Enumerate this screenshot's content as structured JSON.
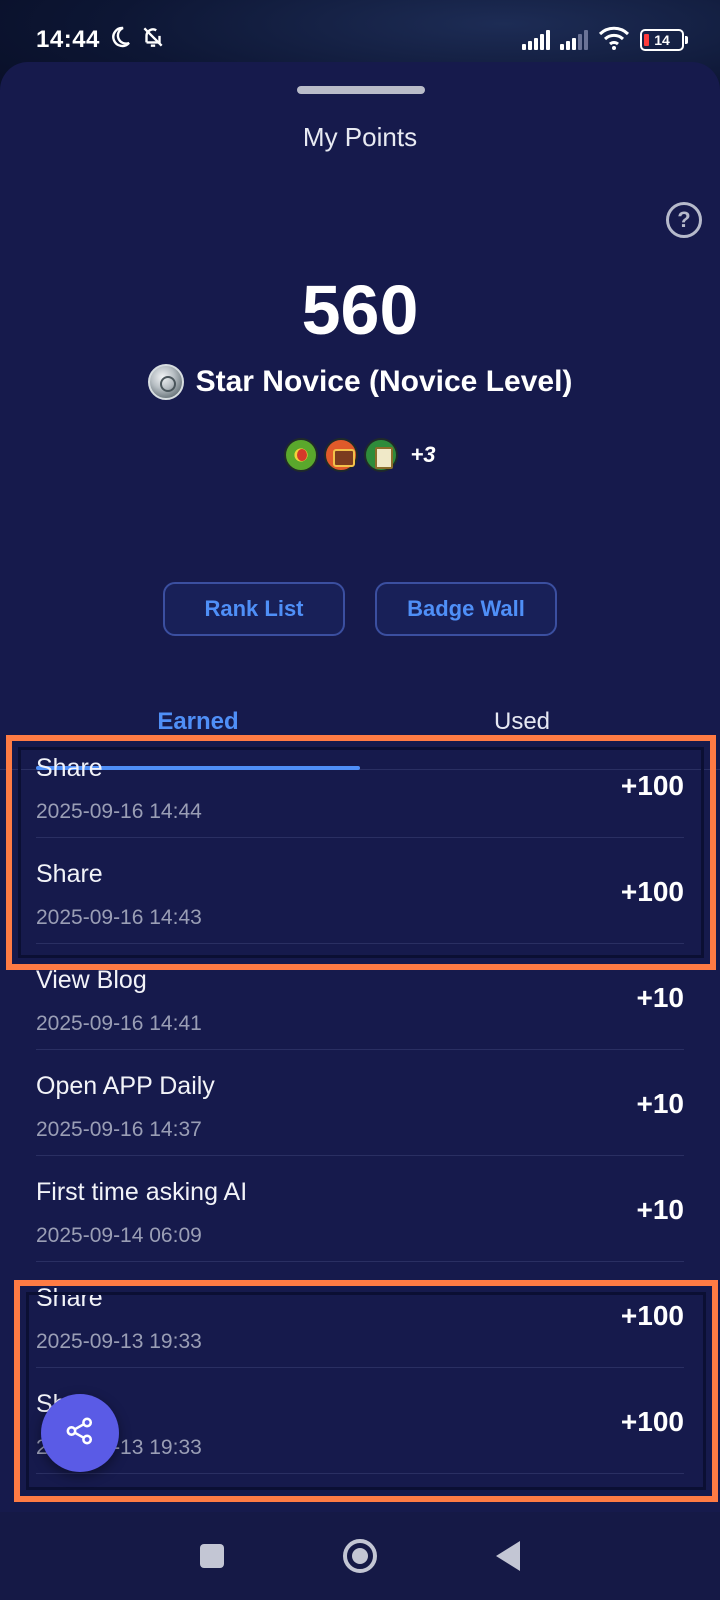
{
  "status_bar": {
    "time": "14:44",
    "battery_level": "14"
  },
  "sheet": {
    "title": "My Points",
    "help_icon": "?"
  },
  "points": {
    "value": "560",
    "level": "Star Novice (Novice Level)",
    "badges_more": "+3"
  },
  "buttons": {
    "rank_list": "Rank List",
    "badge_wall": "Badge Wall"
  },
  "tabs": {
    "earned": "Earned",
    "used": "Used",
    "active": "earned"
  },
  "records": [
    {
      "title": "Share",
      "time": "2025-09-16 14:44",
      "points": "+100"
    },
    {
      "title": "Share",
      "time": "2025-09-16 14:43",
      "points": "+100"
    },
    {
      "title": "View Blog",
      "time": "2025-09-16 14:41",
      "points": "+10"
    },
    {
      "title": "Open APP Daily",
      "time": "2025-09-16 14:37",
      "points": "+10"
    },
    {
      "title": "First time asking AI",
      "time": "2025-09-14 06:09",
      "points": "+10"
    },
    {
      "title": "Share",
      "time": "2025-09-13 19:33",
      "points": "+100"
    },
    {
      "title": "Share",
      "time": "2025-09-13 19:33",
      "points": "+100"
    }
  ],
  "colors": {
    "accent": "#4f8ff7",
    "sheet_bg": "#161a4c",
    "highlight": "#ff7b44",
    "fab": "#5a5be6"
  },
  "icons": {
    "moon": "moon-icon",
    "bell_off": "bell-off-icon",
    "signal": "signal-icon",
    "wifi": "wifi-icon",
    "battery": "battery-icon",
    "help": "help-icon",
    "share": "share-icon"
  }
}
